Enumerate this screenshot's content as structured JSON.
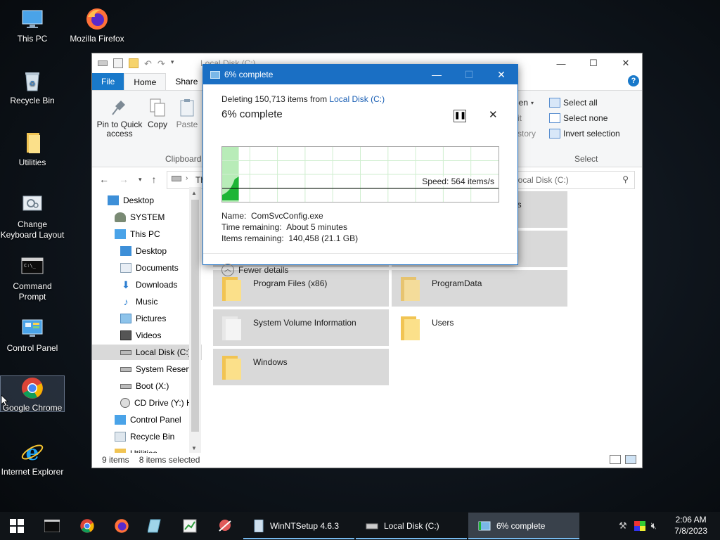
{
  "desktop": {
    "icons": [
      {
        "label": "This PC"
      },
      {
        "label": "Mozilla Firefox"
      },
      {
        "label": "Recycle Bin"
      },
      {
        "label": "Utilities"
      },
      {
        "label": "Change Keyboard Layout"
      },
      {
        "label": "Command Prompt"
      },
      {
        "label": "Control Panel"
      },
      {
        "label": "Google Chrome"
      },
      {
        "label": "Internet Explorer"
      }
    ]
  },
  "explorer": {
    "title": "Local Disk (C:)",
    "tabs": [
      "File",
      "Home",
      "Share"
    ],
    "ribbon": {
      "pin_label": "Pin to Quick access",
      "copy_label": "Copy",
      "paste_label": "Paste",
      "clipboard_group": "Clipboard",
      "open_partial": "pen",
      "edit_partial": "it",
      "history_partial": "story",
      "select_all": "Select all",
      "select_none": "Select none",
      "invert_selection": "Invert selection",
      "select_group": "Select"
    },
    "address_partial": "Th",
    "search_placeholder": "h Local Disk (C:)",
    "nav": [
      {
        "label": "Desktop"
      },
      {
        "label": "SYSTEM"
      },
      {
        "label": "This PC"
      },
      {
        "label": "Desktop"
      },
      {
        "label": "Documents"
      },
      {
        "label": "Downloads"
      },
      {
        "label": "Music"
      },
      {
        "label": "Pictures"
      },
      {
        "label": "Videos"
      },
      {
        "label": "Local Disk (C:)"
      },
      {
        "label": "System Reserve"
      },
      {
        "label": "Boot (X:)"
      },
      {
        "label": "CD Drive (Y:) H"
      },
      {
        "label": "Control Panel"
      },
      {
        "label": "Recycle Bin"
      },
      {
        "label": "Utilities"
      }
    ],
    "items": [
      {
        "name": "gs"
      },
      {
        "name": ""
      },
      {
        "name": ""
      },
      {
        "name": "Program Files (x86)"
      },
      {
        "name": "ProgramData"
      },
      {
        "name": "System Volume Information"
      },
      {
        "name": "Users"
      },
      {
        "name": "Windows"
      }
    ],
    "status": {
      "count": "9 items",
      "selected": "8 items selected"
    }
  },
  "dialog": {
    "title": "6% complete",
    "deleting_prefix": "Deleting 150,713 items from ",
    "deleting_source": "Local Disk (C:)",
    "percent_text": "6% complete",
    "progress_percent": 6,
    "speed": "Speed: 564 items/s",
    "name_label": "Name:",
    "name_value": "ComSvcConfig.exe",
    "time_label": "Time remaining:",
    "time_value": "About 5 minutes",
    "items_label": "Items remaining:",
    "items_value": "140,458 (21.1 GB)",
    "fewer_details": "Fewer details"
  },
  "taskbar": {
    "tasks": [
      {
        "label": "WinNTSetup 4.6.3"
      },
      {
        "label": "Local Disk (C:)"
      },
      {
        "label": "6% complete"
      }
    ],
    "time": "2:06 AM",
    "date": "7/8/2023"
  },
  "colors": {
    "accent": "#1a6fc4",
    "file_tab": "#1979ca",
    "graph_fill": "#1db536",
    "selection": "#cce8ff"
  }
}
